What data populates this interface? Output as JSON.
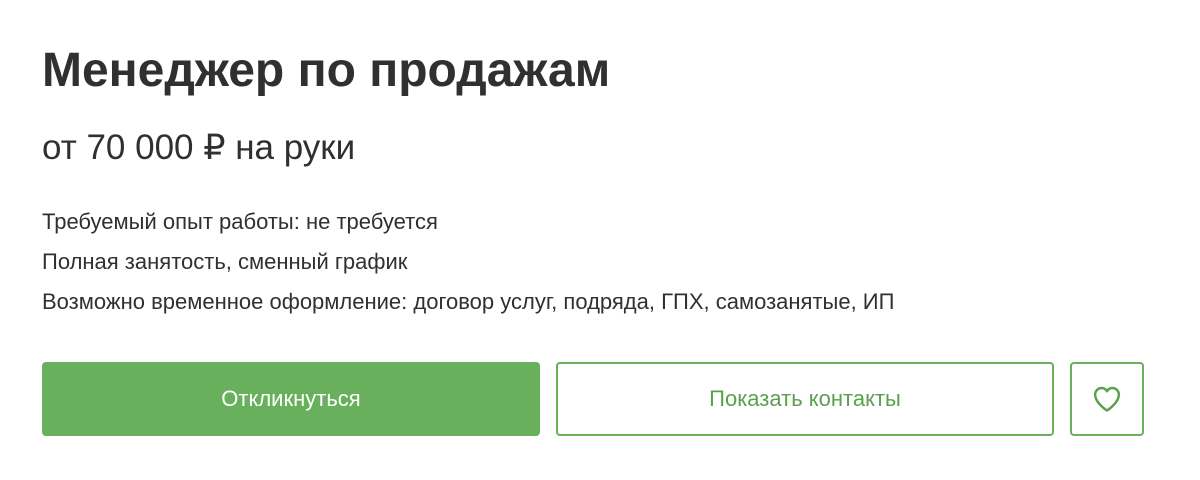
{
  "vacancy": {
    "title": "Менеджер по продажам",
    "salary": "от 70 000 ₽ на руки",
    "details": [
      "Требуемый опыт работы: не требуется",
      "Полная занятость, сменный график",
      "Возможно временное оформление: договор услуг, подряда, ГПХ, самозанятые, ИП"
    ]
  },
  "actions": {
    "respond_label": "Откликнуться",
    "show_contacts_label": "Показать контакты",
    "favorite_icon": "heart-icon"
  },
  "colors": {
    "accent_green": "#68b05c",
    "accent_green_text": "#5aa14e",
    "text_primary": "#303030"
  }
}
